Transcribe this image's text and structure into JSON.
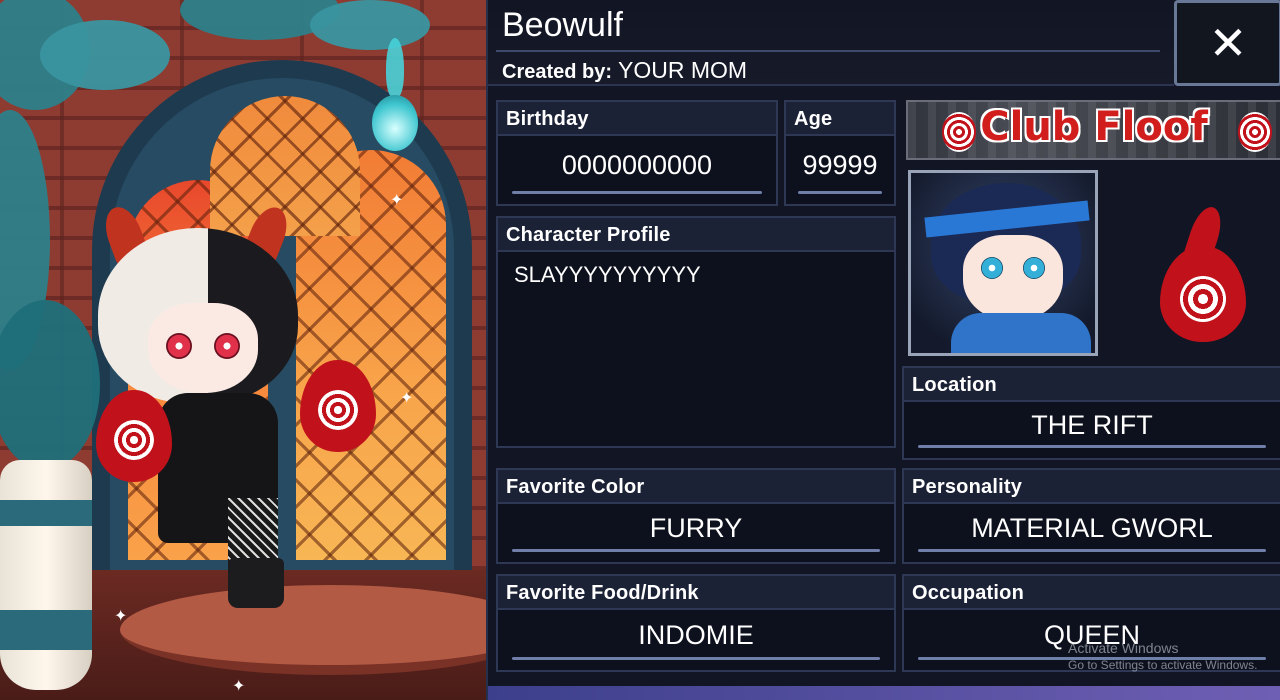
{
  "character": {
    "name": "Beowulf",
    "created_by_label": "Created by:",
    "created_by_value": "YOUR MOM"
  },
  "close_button": {
    "icon": "close-icon",
    "glyph": "✕"
  },
  "fields": {
    "birthday": {
      "label": "Birthday",
      "value": "0000000000"
    },
    "age": {
      "label": "Age",
      "value": "99999"
    },
    "profile": {
      "label": "Character Profile",
      "value": "SLAYYYYYYYYYY"
    },
    "location": {
      "label": "Location",
      "value": "THE RIFT"
    },
    "favorite_color": {
      "label": "Favorite Color",
      "value": "FURRY"
    },
    "personality": {
      "label": "Personality",
      "value": "MATERIAL GWORL"
    },
    "favorite_food": {
      "label": "Favorite Food/Drink",
      "value": "INDOMIE"
    },
    "occupation": {
      "label": "Occupation",
      "value": "QUEEN"
    }
  },
  "banner": {
    "text": "Club Floof"
  },
  "watermark": {
    "title": "Activate Windows",
    "subtitle": "Go to Settings to activate Windows."
  },
  "colors": {
    "panel_bg": "#121523",
    "field_label_bg": "#1c2236",
    "accent_underline": "#6f7fa8",
    "fire_red": "#c1121c",
    "window_orange": "#f7843a"
  }
}
